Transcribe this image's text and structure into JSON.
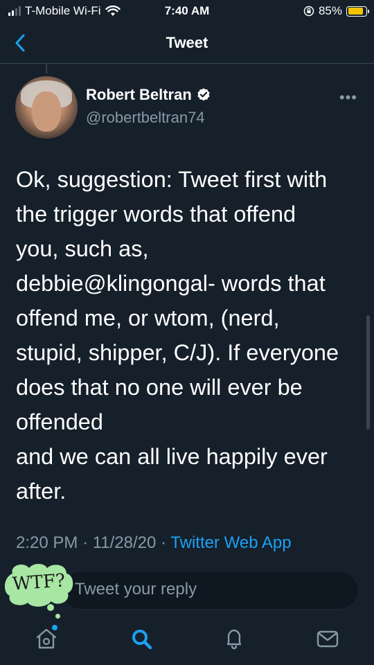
{
  "status_bar": {
    "carrier": "T-Mobile Wi-Fi",
    "time": "7:40 AM",
    "battery": "85%",
    "battery_level": 0.85,
    "battery_color": "#f5c400"
  },
  "header": {
    "title": "Tweet",
    "back_icon": "chevron-left-icon"
  },
  "tweet": {
    "author_name": "Robert Beltran",
    "handle": "@robertbeltran74",
    "text": "Ok, suggestion: Tweet first with\nthe trigger words that offend\nyou, such as,\ndebbie@klingongal- words that\noffend me, or wtom, (nerd,\nstupid, shipper, C/J). If everyone\ndoes that no one will ever be\noffended\nand we can all live happily ever\nafter.",
    "time": "2:20 PM",
    "date": "11/28/20",
    "separator": "·",
    "source": "Twitter Web App"
  },
  "reply": {
    "placeholder": "Tweet your reply",
    "sticker_text": "WTF?",
    "sticker_color": "#a8e6a3"
  },
  "nav": {
    "items": [
      "home-icon",
      "search-icon",
      "notifications-icon",
      "messages-icon"
    ],
    "active": "search-icon"
  },
  "colors": {
    "background": "#15202b",
    "accent": "#1da1f2",
    "secondary_text": "#8899a6",
    "divider": "#38444d"
  }
}
